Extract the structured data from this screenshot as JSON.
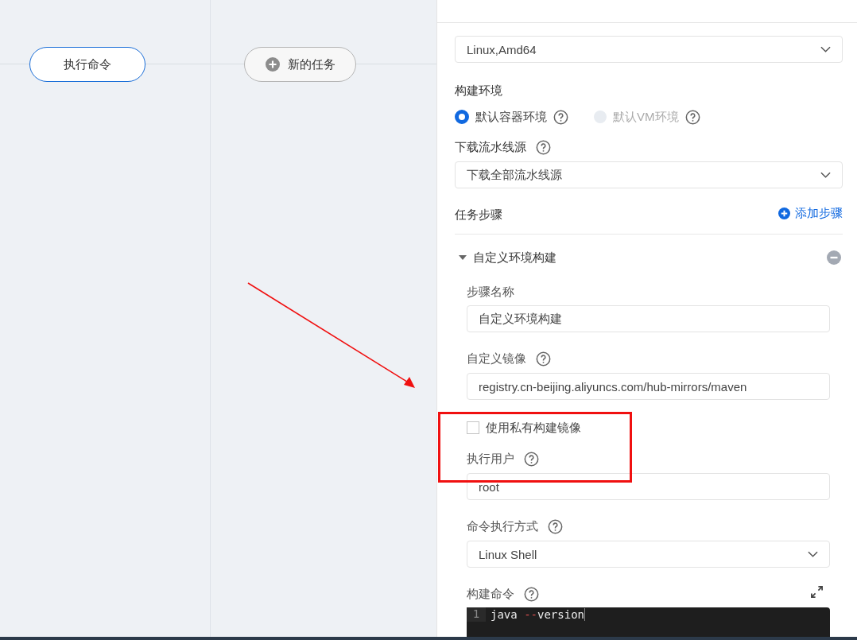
{
  "pipeline": {
    "nodes": [
      {
        "label": "执行命令",
        "kind": "task",
        "selected": true
      },
      {
        "label": "新的任务",
        "kind": "add",
        "selected": false
      }
    ]
  },
  "panel": {
    "build_node": {
      "value": "Linux,Amd64"
    },
    "build_env": {
      "label": "构建环境",
      "options": [
        {
          "label": "默认容器环境",
          "selected": true,
          "disabled": false
        },
        {
          "label": "默认VM环境",
          "selected": false,
          "disabled": true
        }
      ]
    },
    "download_source": {
      "label": "下载流水线源",
      "value": "下载全部流水线源"
    },
    "steps": {
      "label": "任务步骤",
      "add_button": "添加步骤",
      "step": {
        "title": "自定义环境构建",
        "expanded": true,
        "name": {
          "label": "步骤名称",
          "value": "自定义环境构建"
        },
        "image": {
          "label": "自定义镜像",
          "value": "registry.cn-beijing.aliyuncs.com/hub-mirrors/maven"
        },
        "private_image": {
          "label": "使用私有构建镜像",
          "checked": false
        },
        "user": {
          "label": "执行用户",
          "value": "root"
        },
        "exec_mode": {
          "label": "命令执行方式",
          "value": "Linux Shell"
        },
        "command": {
          "label": "构建命令",
          "lines": [
            {
              "number": "1",
              "tokens": [
                {
                  "text": "java ",
                  "kind": "plain"
                },
                {
                  "text": "--",
                  "kind": "operator"
                },
                {
                  "text": "version",
                  "kind": "plain"
                }
              ]
            }
          ]
        }
      }
    }
  }
}
